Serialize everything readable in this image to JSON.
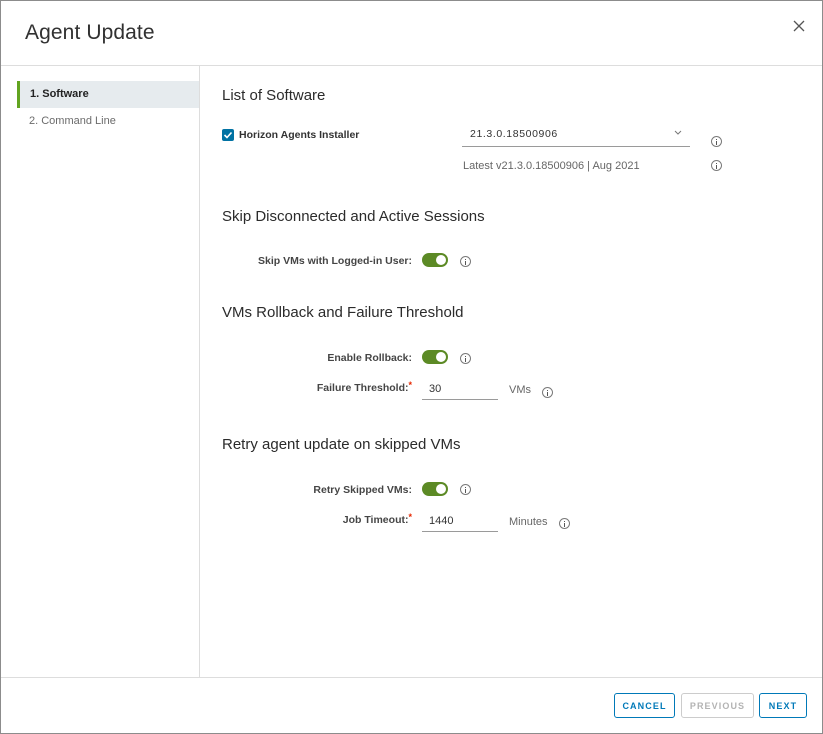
{
  "dialog": {
    "title": "Agent Update",
    "close_icon": "close-icon"
  },
  "steps": [
    {
      "label": "1. Software",
      "active": true
    },
    {
      "label": "2. Command Line",
      "active": false
    }
  ],
  "software": {
    "section_title": "List of Software",
    "installer_label": "Horizon Agents Installer",
    "installer_checked": true,
    "version_selected": "21.3.0.18500906",
    "latest_text": "Latest v21.3.0.18500906 | Aug 2021"
  },
  "skip_sessions": {
    "section_title": "Skip Disconnected and Active Sessions",
    "skip_logged_in_label": "Skip VMs with Logged-in User:",
    "skip_logged_in_enabled": true
  },
  "rollback": {
    "section_title": "VMs Rollback and Failure Threshold",
    "enable_rollback_label": "Enable Rollback:",
    "enable_rollback_enabled": true,
    "failure_threshold_label": "Failure Threshold:",
    "failure_threshold_value": "30",
    "failure_threshold_unit": "VMs",
    "required_marker": "*"
  },
  "retry": {
    "section_title": "Retry agent update on skipped VMs",
    "retry_label": "Retry Skipped VMs:",
    "retry_enabled": true,
    "job_timeout_label": "Job Timeout:",
    "job_timeout_value": "1440",
    "job_timeout_unit": "Minutes",
    "required_marker": "*"
  },
  "footer": {
    "cancel_label": "CANCEL",
    "previous_label": "PREVIOUS",
    "next_label": "NEXT",
    "previous_disabled": true
  },
  "colors": {
    "accent": "#0079b8",
    "toggle_on": "#5c8a25",
    "active_step_marker": "#62a420",
    "required": "#e62700"
  }
}
